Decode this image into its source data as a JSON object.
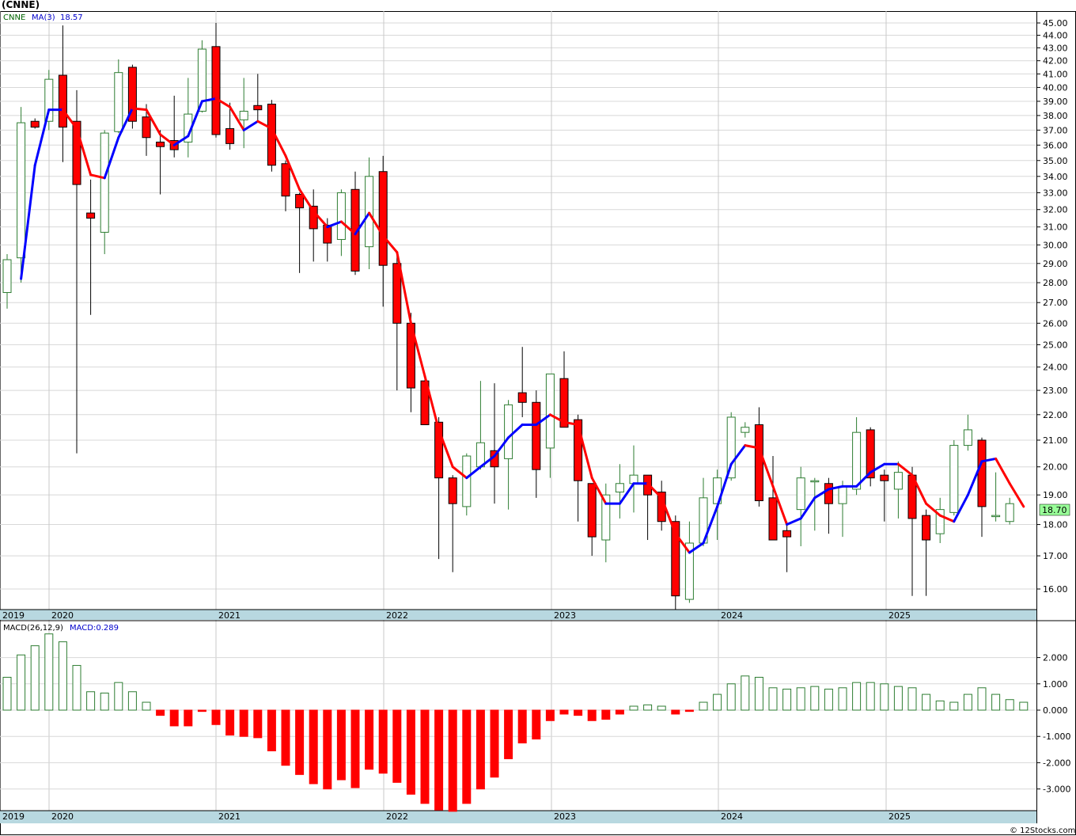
{
  "title": "(CNNE)",
  "legend": {
    "symbol": "CNNE",
    "ma_label": "MA(3)",
    "ma_value": "18.57"
  },
  "macd_legend": {
    "label": "MACD(26,12,9)",
    "value_label": "MACD:0.289"
  },
  "last_price": "18.70",
  "watermark": "© 12Stocks.com",
  "colors": {
    "up": "#2e7d32",
    "down": "#ff0000",
    "ma_up": "#0000ff",
    "ma_down": "#ff0000",
    "axis_band": "#b8d8e0"
  },
  "chart_data": [
    {
      "type": "candlestick",
      "title": "(CNNE)",
      "ylim": [
        15.4,
        45.6
      ],
      "y_scale": "log",
      "y_ticks": [
        "16.00",
        "17.00",
        "18.00",
        "19.00",
        "20.00",
        "21.00",
        "22.00",
        "23.00",
        "24.00",
        "25.00",
        "26.00",
        "27.00",
        "28.00",
        "29.00",
        "30.00",
        "31.00",
        "32.00",
        "33.00",
        "34.00",
        "35.00",
        "36.00",
        "37.00",
        "38.00",
        "39.00",
        "40.00",
        "41.00",
        "42.00",
        "43.00",
        "44.00",
        "45.00"
      ],
      "year_labels": [
        "2019",
        "2020",
        "2021",
        "2022",
        "2023",
        "2024",
        "2025"
      ],
      "grid": true,
      "candles": [
        {
          "o": 27.5,
          "h": 29.5,
          "l": 26.7,
          "c": 29.2
        },
        {
          "o": 29.3,
          "h": 38.6,
          "l": 28.0,
          "c": 37.5
        },
        {
          "o": 37.6,
          "h": 37.8,
          "l": 37.1,
          "c": 37.2
        },
        {
          "o": 37.6,
          "h": 41.3,
          "l": 37.0,
          "c": 40.6
        },
        {
          "o": 40.9,
          "h": 44.8,
          "l": 34.9,
          "c": 37.2
        },
        {
          "o": 37.6,
          "h": 39.8,
          "l": 20.5,
          "c": 33.5
        },
        {
          "o": 31.8,
          "h": 33.8,
          "l": 26.4,
          "c": 31.5
        },
        {
          "o": 30.7,
          "h": 37.0,
          "l": 29.5,
          "c": 36.8
        },
        {
          "o": 36.9,
          "h": 42.1,
          "l": 36.8,
          "c": 41.1
        },
        {
          "o": 41.5,
          "h": 41.7,
          "l": 37.1,
          "c": 37.6
        },
        {
          "o": 37.9,
          "h": 38.8,
          "l": 35.3,
          "c": 36.5
        },
        {
          "o": 36.2,
          "h": 37.0,
          "l": 32.9,
          "c": 35.9
        },
        {
          "o": 36.3,
          "h": 39.4,
          "l": 35.2,
          "c": 35.7
        },
        {
          "o": 36.2,
          "h": 40.7,
          "l": 35.2,
          "c": 38.1
        },
        {
          "o": 38.3,
          "h": 43.6,
          "l": 38.2,
          "c": 42.9
        },
        {
          "o": 43.1,
          "h": 45.0,
          "l": 36.5,
          "c": 36.7
        },
        {
          "o": 37.1,
          "h": 38.9,
          "l": 35.7,
          "c": 36.1
        },
        {
          "o": 37.7,
          "h": 40.7,
          "l": 35.8,
          "c": 38.3
        },
        {
          "o": 38.7,
          "h": 41.0,
          "l": 37.6,
          "c": 38.4
        },
        {
          "o": 38.8,
          "h": 39.1,
          "l": 34.3,
          "c": 34.7
        },
        {
          "o": 34.8,
          "h": 35.0,
          "l": 31.9,
          "c": 32.8
        },
        {
          "o": 32.9,
          "h": 33.0,
          "l": 28.5,
          "c": 32.1
        },
        {
          "o": 32.2,
          "h": 33.2,
          "l": 29.1,
          "c": 30.9
        },
        {
          "o": 31.1,
          "h": 31.5,
          "l": 29.1,
          "c": 30.1
        },
        {
          "o": 30.3,
          "h": 33.2,
          "l": 29.4,
          "c": 33.0
        },
        {
          "o": 33.2,
          "h": 34.3,
          "l": 28.4,
          "c": 28.6
        },
        {
          "o": 29.9,
          "h": 35.2,
          "l": 28.7,
          "c": 34.0
        },
        {
          "o": 34.3,
          "h": 35.3,
          "l": 26.8,
          "c": 28.9
        },
        {
          "o": 29.0,
          "h": 29.6,
          "l": 23.0,
          "c": 26.0
        },
        {
          "o": 26.0,
          "h": 26.5,
          "l": 22.1,
          "c": 23.1
        },
        {
          "o": 23.4,
          "h": 23.5,
          "l": 21.6,
          "c": 21.6
        },
        {
          "o": 21.7,
          "h": 21.9,
          "l": 16.9,
          "c": 19.6
        },
        {
          "o": 19.6,
          "h": 19.7,
          "l": 16.5,
          "c": 18.7
        },
        {
          "o": 18.6,
          "h": 20.5,
          "l": 18.3,
          "c": 20.4
        },
        {
          "o": 20.0,
          "h": 23.4,
          "l": 19.9,
          "c": 20.9
        },
        {
          "o": 20.6,
          "h": 23.3,
          "l": 18.7,
          "c": 20.0
        },
        {
          "o": 20.3,
          "h": 22.6,
          "l": 18.5,
          "c": 22.4
        },
        {
          "o": 22.9,
          "h": 24.9,
          "l": 21.9,
          "c": 22.5
        },
        {
          "o": 22.5,
          "h": 23.0,
          "l": 18.9,
          "c": 19.9
        },
        {
          "o": 20.7,
          "h": 23.7,
          "l": 19.6,
          "c": 23.7
        },
        {
          "o": 23.5,
          "h": 24.7,
          "l": 21.5,
          "c": 21.5
        },
        {
          "o": 21.8,
          "h": 22.0,
          "l": 18.1,
          "c": 19.5
        },
        {
          "o": 19.4,
          "h": 19.4,
          "l": 17.0,
          "c": 17.6
        },
        {
          "o": 17.5,
          "h": 19.4,
          "l": 16.8,
          "c": 19.0
        },
        {
          "o": 19.1,
          "h": 20.1,
          "l": 18.2,
          "c": 19.4
        },
        {
          "o": 19.4,
          "h": 20.8,
          "l": 18.4,
          "c": 19.7
        },
        {
          "o": 19.7,
          "h": 19.7,
          "l": 17.5,
          "c": 19.0
        },
        {
          "o": 19.1,
          "h": 19.5,
          "l": 17.8,
          "c": 18.1
        },
        {
          "o": 18.1,
          "h": 18.3,
          "l": 15.4,
          "c": 15.8
        },
        {
          "o": 15.7,
          "h": 18.1,
          "l": 15.6,
          "c": 17.4
        },
        {
          "o": 17.4,
          "h": 19.6,
          "l": 17.3,
          "c": 18.9
        },
        {
          "o": 18.7,
          "h": 19.9,
          "l": 17.5,
          "c": 19.6
        },
        {
          "o": 19.6,
          "h": 22.1,
          "l": 19.5,
          "c": 21.9
        },
        {
          "o": 21.3,
          "h": 21.7,
          "l": 21.1,
          "c": 21.5
        },
        {
          "o": 21.6,
          "h": 22.3,
          "l": 18.6,
          "c": 18.8
        },
        {
          "o": 18.9,
          "h": 20.4,
          "l": 17.5,
          "c": 17.5
        },
        {
          "o": 17.8,
          "h": 18.1,
          "l": 16.5,
          "c": 17.6
        },
        {
          "o": 18.5,
          "h": 20.0,
          "l": 17.3,
          "c": 19.6
        },
        {
          "o": 19.5,
          "h": 19.6,
          "l": 17.8,
          "c": 19.5
        },
        {
          "o": 19.4,
          "h": 19.6,
          "l": 17.7,
          "c": 18.7
        },
        {
          "o": 18.7,
          "h": 19.5,
          "l": 17.6,
          "c": 19.3
        },
        {
          "o": 19.2,
          "h": 21.9,
          "l": 19.0,
          "c": 21.3
        },
        {
          "o": 21.4,
          "h": 21.5,
          "l": 19.3,
          "c": 19.6
        },
        {
          "o": 19.7,
          "h": 19.9,
          "l": 18.1,
          "c": 19.5
        },
        {
          "o": 19.2,
          "h": 20.2,
          "l": 18.2,
          "c": 19.8
        },
        {
          "o": 19.7,
          "h": 20.0,
          "l": 15.8,
          "c": 18.2
        },
        {
          "o": 18.3,
          "h": 18.5,
          "l": 15.8,
          "c": 17.5
        },
        {
          "o": 17.7,
          "h": 18.9,
          "l": 17.4,
          "c": 18.5
        },
        {
          "o": 18.4,
          "h": 21.0,
          "l": 18.3,
          "c": 20.8
        },
        {
          "o": 20.8,
          "h": 22.0,
          "l": 20.6,
          "c": 21.4
        },
        {
          "o": 21.0,
          "h": 21.1,
          "l": 17.6,
          "c": 18.6
        },
        {
          "o": 18.3,
          "h": 19.8,
          "l": 18.1,
          "c": 18.3
        },
        {
          "o": 18.1,
          "h": 18.9,
          "l": 18.0,
          "c": 18.7
        }
      ],
      "ma3": [
        null,
        28.2,
        34.7,
        38.4,
        38.4,
        37.1,
        34.1,
        33.9,
        36.5,
        38.5,
        38.4,
        36.7,
        36.0,
        36.6,
        39.0,
        39.2,
        38.6,
        37.0,
        37.6,
        37.1,
        35.3,
        33.2,
        31.9,
        31.0,
        31.3,
        30.6,
        31.8,
        30.5,
        29.6,
        26.0,
        23.6,
        21.4,
        20.0,
        19.6,
        20.0,
        20.4,
        21.1,
        21.6,
        21.6,
        22.0,
        21.7,
        21.6,
        19.6,
        18.7,
        18.7,
        19.4,
        19.4,
        18.9,
        17.7,
        17.1,
        17.4,
        18.6,
        20.1,
        20.8,
        20.7,
        19.3,
        18.0,
        18.2,
        18.9,
        19.2,
        19.3,
        19.3,
        19.8,
        20.1,
        20.1,
        19.7,
        18.7,
        18.3,
        18.1,
        19.0,
        20.2,
        20.3,
        19.4,
        18.6
      ]
    },
    {
      "type": "bar",
      "title": "MACD(26,12,9)",
      "ylim": [
        -3.9,
        3.1
      ],
      "y_ticks": [
        "-3.000",
        "-2.000",
        "-1.000",
        "0.000",
        "1.000",
        "2.000"
      ],
      "values": [
        1.25,
        2.1,
        2.45,
        2.9,
        2.6,
        1.7,
        0.7,
        0.65,
        1.05,
        0.7,
        0.3,
        -0.2,
        -0.6,
        -0.6,
        -0.05,
        -0.55,
        -0.95,
        -1.0,
        -1.05,
        -1.55,
        -2.1,
        -2.45,
        -2.8,
        -3.0,
        -2.65,
        -2.95,
        -2.25,
        -2.4,
        -2.75,
        -3.2,
        -3.55,
        -3.8,
        -3.85,
        -3.55,
        -3.0,
        -2.55,
        -1.85,
        -1.25,
        -1.1,
        -0.4,
        -0.15,
        -0.2,
        -0.4,
        -0.35,
        -0.15,
        0.15,
        0.2,
        0.15,
        -0.15,
        -0.05,
        0.3,
        0.6,
        1.0,
        1.3,
        1.25,
        0.85,
        0.8,
        0.85,
        0.9,
        0.8,
        0.85,
        1.05,
        1.05,
        1.0,
        0.9,
        0.85,
        0.6,
        0.35,
        0.3,
        0.6,
        0.85,
        0.6,
        0.4,
        0.3
      ]
    }
  ]
}
